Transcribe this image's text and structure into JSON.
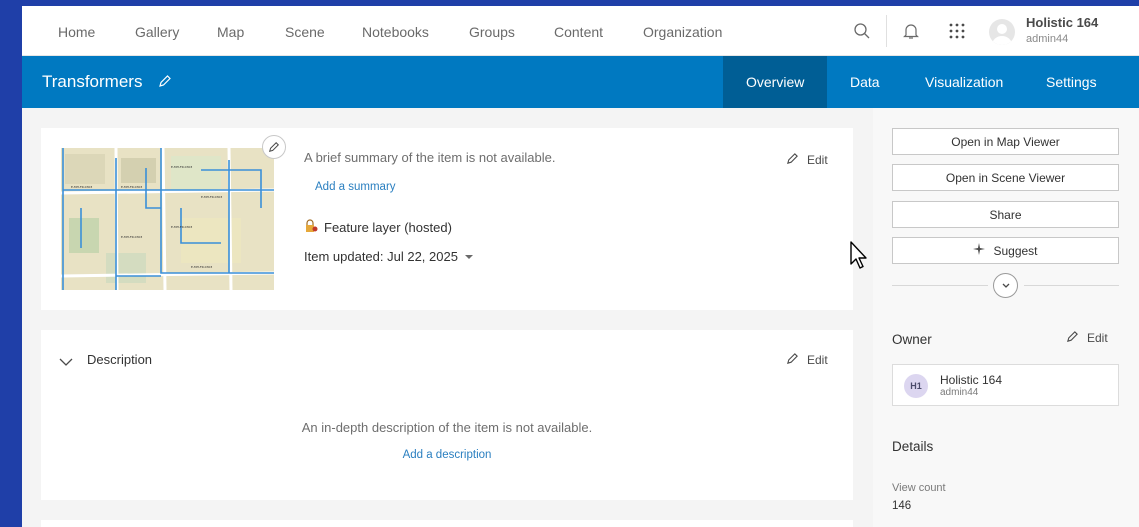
{
  "nav": {
    "links": [
      "Home",
      "Gallery",
      "Map",
      "Scene",
      "Notebooks",
      "Groups",
      "Content",
      "Organization"
    ],
    "user_name": "Holistic 164",
    "user_login": "admin44"
  },
  "item": {
    "title": "Transformers",
    "tabs": [
      "Overview",
      "Data",
      "Visualization",
      "Settings"
    ],
    "active_tab": "Overview"
  },
  "summary": {
    "text": "A brief summary of the item is not available.",
    "add_link": "Add a summary",
    "type": "Feature layer (hosted)",
    "updated": "Item updated: Jul 22, 2025",
    "edit_label": "Edit"
  },
  "description": {
    "title": "Description",
    "edit_label": "Edit",
    "empty_text": "An in-depth description of the item is not available.",
    "add_link": "Add a description"
  },
  "sidebar": {
    "buttons": [
      "Open in Map Viewer",
      "Open in Scene Viewer",
      "Share",
      "Suggest"
    ],
    "owner_heading": "Owner",
    "owner_edit": "Edit",
    "owner_initials": "H1",
    "owner_name": "Holistic 164",
    "owner_user": "admin44",
    "details_heading": "Details",
    "view_count_label": "View count",
    "view_count": "146"
  },
  "colors": {
    "brand_blue": "#0079c1",
    "active_tab": "#005e95",
    "link": "#2a7fc0",
    "desktop": "#1f3fa8"
  }
}
